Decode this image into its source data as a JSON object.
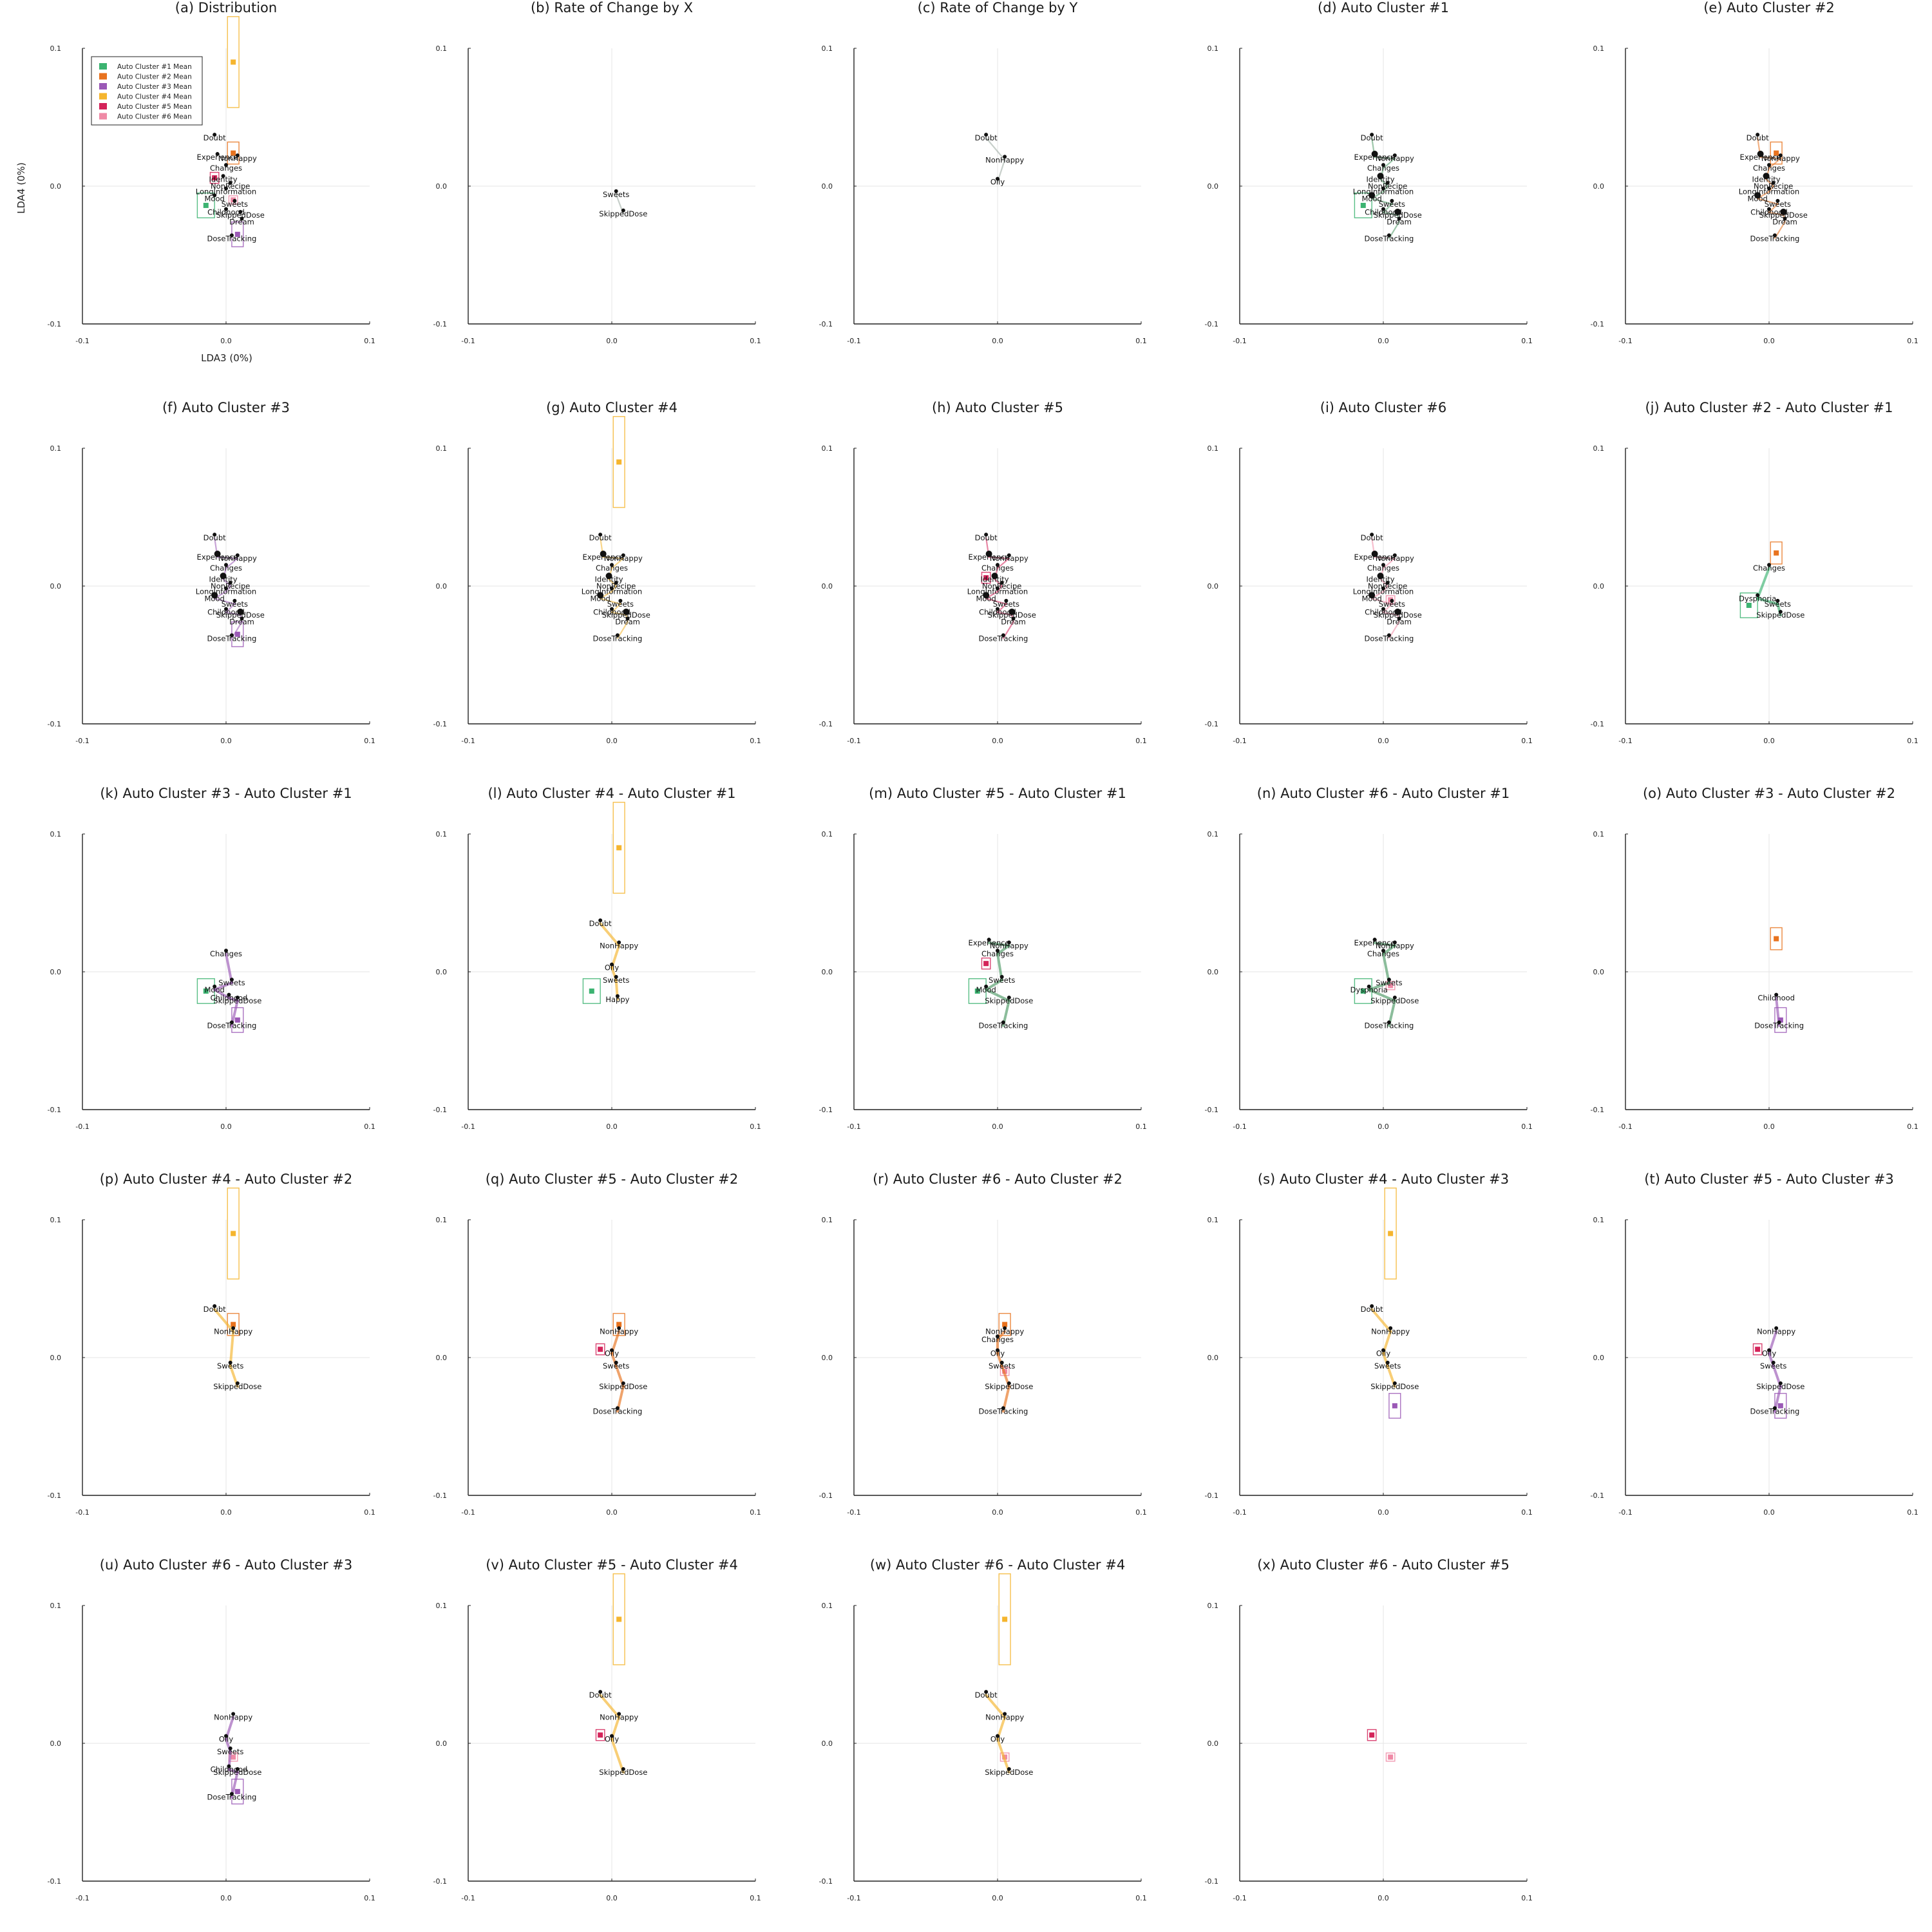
{
  "figure": {
    "legend_position": "top-left of panel (a)",
    "legend": [
      {
        "label": "Auto Cluster #1 Mean",
        "color": "#3cb371"
      },
      {
        "label": "Auto Cluster #2 Mean",
        "color": "#e8731f"
      },
      {
        "label": "Auto Cluster #3 Mean",
        "color": "#9b59b6"
      },
      {
        "label": "Auto Cluster #4 Mean",
        "color": "#f5b52e"
      },
      {
        "label": "Auto Cluster #5 Mean",
        "color": "#d4245a"
      },
      {
        "label": "Auto Cluster #6 Mean",
        "color": "#ef8aa6"
      }
    ]
  },
  "chart_data": [
    {
      "title": "(a) Distribution",
      "type": "scatter",
      "xlabel": "LDA3 (0%)",
      "ylabel": "LDA4 (0%)",
      "xlim": [
        -0.1,
        0.1
      ],
      "ylim": [
        -0.1,
        0.1
      ],
      "xticks": [
        "-0.1",
        "0.0",
        "0.1"
      ],
      "yticks": [
        "-0.1",
        "0.0",
        "0.1"
      ],
      "grid": true,
      "means": [
        {
          "cluster": 1,
          "x": -0.014,
          "y": -0.014
        },
        {
          "cluster": 2,
          "x": 0.005,
          "y": 0.024
        },
        {
          "cluster": 3,
          "x": 0.008,
          "y": -0.035
        },
        {
          "cluster": 4,
          "x": 0.005,
          "y": 0.09
        },
        {
          "cluster": 5,
          "x": -0.008,
          "y": 0.006
        },
        {
          "cluster": 6,
          "x": 0.005,
          "y": -0.01
        }
      ],
      "labels": [
        {
          "text": "Doubt",
          "x": -0.008,
          "y": 0.035
        },
        {
          "text": "Experience",
          "x": -0.006,
          "y": 0.021
        },
        {
          "text": "NonHappy",
          "x": 0.008,
          "y": 0.02
        },
        {
          "text": "Changes",
          "x": 0.0,
          "y": 0.013
        },
        {
          "text": "Identity",
          "x": -0.002,
          "y": 0.005
        },
        {
          "text": "NonRecipe",
          "x": 0.003,
          "y": 0.0
        },
        {
          "text": "LongInformation",
          "x": 0.0,
          "y": -0.004
        },
        {
          "text": "Mood",
          "x": -0.008,
          "y": -0.009
        },
        {
          "text": "Sweets",
          "x": 0.006,
          "y": -0.013
        },
        {
          "text": "Childhood",
          "x": 0.0,
          "y": -0.019
        },
        {
          "text": "SkippedDose",
          "x": 0.01,
          "y": -0.021
        },
        {
          "text": "Dream",
          "x": 0.011,
          "y": -0.026
        },
        {
          "text": "DoseTracking",
          "x": 0.004,
          "y": -0.038
        }
      ]
    },
    {
      "title": "(b) Rate of Change by X",
      "type": "scatter",
      "xlim": [
        -0.1,
        0.1
      ],
      "ylim": [
        -0.1,
        0.1
      ],
      "xticks": [
        "-0.1",
        "0.0",
        "0.1"
      ],
      "yticks": [
        "-0.1",
        "0.0",
        "0.1"
      ],
      "labels": [
        {
          "text": "Sweets",
          "x": 0.003,
          "y": -0.006
        },
        {
          "text": "SkippedDose",
          "x": 0.008,
          "y": -0.02
        }
      ]
    },
    {
      "title": "(c) Rate of Change by Y",
      "type": "scatter",
      "xlim": [
        -0.1,
        0.1
      ],
      "ylim": [
        -0.1,
        0.1
      ],
      "xticks": [
        "-0.1",
        "0.0",
        "0.1"
      ],
      "yticks": [
        "-0.1",
        "0.0",
        "0.1"
      ],
      "labels": [
        {
          "text": "Doubt",
          "x": -0.008,
          "y": 0.035
        },
        {
          "text": "NonHappy",
          "x": 0.005,
          "y": 0.019
        },
        {
          "text": "Oily",
          "x": 0.0,
          "y": 0.003
        }
      ]
    },
    {
      "title": "(d) Auto Cluster #1",
      "type": "scatter",
      "xlim": [
        -0.1,
        0.1
      ],
      "ylim": [
        -0.1,
        0.1
      ],
      "xticks": [
        "-0.1",
        "0.0",
        "0.1"
      ],
      "yticks": [
        "-0.1",
        "0.0",
        "0.1"
      ]
    },
    {
      "title": "(e) Auto Cluster #2",
      "type": "scatter",
      "xlim": [
        -0.1,
        0.1
      ],
      "ylim": [
        -0.1,
        0.1
      ],
      "xticks": [
        "-0.1",
        "0.0",
        "0.1"
      ],
      "yticks": [
        "-0.1",
        "0.0",
        "0.1"
      ]
    },
    {
      "title": "(f) Auto Cluster #3",
      "type": "scatter",
      "xlim": [
        -0.1,
        0.1
      ],
      "ylim": [
        -0.1,
        0.1
      ],
      "xticks": [
        "-0.1",
        "0.0",
        "0.1"
      ],
      "yticks": [
        "-0.1",
        "0.0",
        "0.1"
      ]
    },
    {
      "title": "(g) Auto Cluster #4",
      "type": "scatter",
      "xlim": [
        -0.1,
        0.1
      ],
      "ylim": [
        -0.1,
        0.1
      ],
      "xticks": [
        "-0.1",
        "0.0",
        "0.1"
      ],
      "yticks": [
        "-0.1",
        "0.0",
        "0.1"
      ]
    },
    {
      "title": "(h) Auto Cluster #5",
      "type": "scatter",
      "xlim": [
        -0.1,
        0.1
      ],
      "ylim": [
        -0.1,
        0.1
      ],
      "xticks": [
        "-0.1",
        "0.0",
        "0.1"
      ],
      "yticks": [
        "-0.1",
        "0.0",
        "0.1"
      ]
    },
    {
      "title": "(i) Auto Cluster #6",
      "type": "scatter",
      "xlim": [
        -0.1,
        0.1
      ],
      "ylim": [
        -0.1,
        0.1
      ],
      "xticks": [
        "-0.1",
        "0.0",
        "0.1"
      ],
      "yticks": [
        "-0.1",
        "0.0",
        "0.1"
      ]
    },
    {
      "title": "(j) Auto Cluster #2 - Auto Cluster #1",
      "type": "scatter",
      "xlim": [
        -0.1,
        0.1
      ],
      "ylim": [
        -0.1,
        0.1
      ],
      "xticks": [
        "-0.1",
        "0.0",
        "0.1"
      ],
      "yticks": [
        "-0.1",
        "0.0",
        "0.1"
      ],
      "labels": [
        {
          "text": "Changes",
          "x": 0.0,
          "y": 0.013
        },
        {
          "text": "Dysphoria",
          "x": -0.008,
          "y": -0.009
        },
        {
          "text": "Sweets",
          "x": 0.006,
          "y": -0.013
        },
        {
          "text": "SkippedDose",
          "x": 0.008,
          "y": -0.021
        }
      ]
    },
    {
      "title": "(k) Auto Cluster #3 - Auto Cluster #1",
      "type": "scatter",
      "xlim": [
        -0.1,
        0.1
      ],
      "ylim": [
        -0.1,
        0.1
      ],
      "xticks": [
        "-0.1",
        "0.0",
        "0.1"
      ],
      "yticks": [
        "-0.1",
        "0.0",
        "0.1"
      ],
      "labels": [
        {
          "text": "Changes",
          "x": 0.0,
          "y": 0.013
        },
        {
          "text": "Sweets",
          "x": 0.004,
          "y": -0.008
        },
        {
          "text": "Mood",
          "x": -0.008,
          "y": -0.013
        },
        {
          "text": "Childhood",
          "x": 0.002,
          "y": -0.019
        },
        {
          "text": "SkippedDose",
          "x": 0.008,
          "y": -0.021
        },
        {
          "text": "DoseTracking",
          "x": 0.004,
          "y": -0.039
        }
      ]
    },
    {
      "title": "(l) Auto Cluster #4 - Auto Cluster #1",
      "type": "scatter",
      "xlim": [
        -0.1,
        0.1
      ],
      "ylim": [
        -0.1,
        0.1
      ],
      "xticks": [
        "-0.1",
        "0.0",
        "0.1"
      ],
      "yticks": [
        "-0.1",
        "0.0",
        "0.1"
      ],
      "labels": [
        {
          "text": "Doubt",
          "x": -0.008,
          "y": 0.035
        },
        {
          "text": "NonHappy",
          "x": 0.005,
          "y": 0.019
        },
        {
          "text": "Oily",
          "x": 0.0,
          "y": 0.003
        },
        {
          "text": "Sweets",
          "x": 0.003,
          "y": -0.006
        },
        {
          "text": "Happy",
          "x": 0.004,
          "y": -0.02
        }
      ]
    },
    {
      "title": "(m) Auto Cluster #5 - Auto Cluster #1",
      "type": "scatter",
      "xlim": [
        -0.1,
        0.1
      ],
      "ylim": [
        -0.1,
        0.1
      ],
      "xticks": [
        "-0.1",
        "0.0",
        "0.1"
      ],
      "yticks": [
        "-0.1",
        "0.0",
        "0.1"
      ],
      "labels": [
        {
          "text": "Experience",
          "x": -0.006,
          "y": 0.021
        },
        {
          "text": "NonHappy",
          "x": 0.008,
          "y": 0.019
        },
        {
          "text": "Changes",
          "x": 0.0,
          "y": 0.013
        },
        {
          "text": "Sweets",
          "x": 0.003,
          "y": -0.006
        },
        {
          "text": "Mood",
          "x": -0.008,
          "y": -0.013
        },
        {
          "text": "SkippedDose",
          "x": 0.008,
          "y": -0.021
        },
        {
          "text": "DoseTracking",
          "x": 0.004,
          "y": -0.039
        }
      ]
    },
    {
      "title": "(n) Auto Cluster #6 - Auto Cluster #1",
      "type": "scatter",
      "xlim": [
        -0.1,
        0.1
      ],
      "ylim": [
        -0.1,
        0.1
      ],
      "xticks": [
        "-0.1",
        "0.0",
        "0.1"
      ],
      "yticks": [
        "-0.1",
        "0.0",
        "0.1"
      ],
      "labels": [
        {
          "text": "Experience",
          "x": -0.006,
          "y": 0.021
        },
        {
          "text": "NonHappy",
          "x": 0.008,
          "y": 0.019
        },
        {
          "text": "Changes",
          "x": 0.0,
          "y": 0.013
        },
        {
          "text": "Sweets",
          "x": 0.004,
          "y": -0.008
        },
        {
          "text": "Dysphoria",
          "x": -0.01,
          "y": -0.013
        },
        {
          "text": "SkippedDose",
          "x": 0.008,
          "y": -0.021
        },
        {
          "text": "DoseTracking",
          "x": 0.004,
          "y": -0.039
        }
      ]
    },
    {
      "title": "(o) Auto Cluster #3 - Auto Cluster #2",
      "type": "scatter",
      "xlim": [
        -0.1,
        0.1
      ],
      "ylim": [
        -0.1,
        0.1
      ],
      "xticks": [
        "-0.1",
        "0.0",
        "0.1"
      ],
      "yticks": [
        "-0.1",
        "0.0",
        "0.1"
      ],
      "labels": [
        {
          "text": "Childhood",
          "x": 0.005,
          "y": -0.019
        },
        {
          "text": "DoseTracking",
          "x": 0.007,
          "y": -0.039
        }
      ]
    },
    {
      "title": "(p) Auto Cluster #4 - Auto Cluster #2",
      "type": "scatter",
      "xlim": [
        -0.1,
        0.1
      ],
      "ylim": [
        -0.1,
        0.1
      ],
      "xticks": [
        "-0.1",
        "0.0",
        "0.1"
      ],
      "yticks": [
        "-0.1",
        "0.0",
        "0.1"
      ],
      "labels": [
        {
          "text": "Doubt",
          "x": -0.008,
          "y": 0.035
        },
        {
          "text": "NonHappy",
          "x": 0.005,
          "y": 0.019
        },
        {
          "text": "Sweets",
          "x": 0.003,
          "y": -0.006
        },
        {
          "text": "SkippedDose",
          "x": 0.008,
          "y": -0.021
        }
      ]
    },
    {
      "title": "(q) Auto Cluster #5 - Auto Cluster #2",
      "type": "scatter",
      "xlim": [
        -0.1,
        0.1
      ],
      "ylim": [
        -0.1,
        0.1
      ],
      "xticks": [
        "-0.1",
        "0.0",
        "0.1"
      ],
      "yticks": [
        "-0.1",
        "0.0",
        "0.1"
      ],
      "labels": [
        {
          "text": "NonHappy",
          "x": 0.005,
          "y": 0.019
        },
        {
          "text": "Oily",
          "x": 0.0,
          "y": 0.003
        },
        {
          "text": "Sweets",
          "x": 0.003,
          "y": -0.006
        },
        {
          "text": "SkippedDose",
          "x": 0.008,
          "y": -0.021
        },
        {
          "text": "DoseTracking",
          "x": 0.004,
          "y": -0.039
        }
      ]
    },
    {
      "title": "(r) Auto Cluster #6 - Auto Cluster #2",
      "type": "scatter",
      "xlim": [
        -0.1,
        0.1
      ],
      "ylim": [
        -0.1,
        0.1
      ],
      "xticks": [
        "-0.1",
        "0.0",
        "0.1"
      ],
      "yticks": [
        "-0.1",
        "0.0",
        "0.1"
      ],
      "labels": [
        {
          "text": "NonHappy",
          "x": 0.005,
          "y": 0.019
        },
        {
          "text": "Changes",
          "x": 0.0,
          "y": 0.013
        },
        {
          "text": "Oily",
          "x": 0.0,
          "y": 0.003
        },
        {
          "text": "Sweets",
          "x": 0.003,
          "y": -0.006
        },
        {
          "text": "SkippedDose",
          "x": 0.008,
          "y": -0.021
        },
        {
          "text": "DoseTracking",
          "x": 0.004,
          "y": -0.039
        }
      ]
    },
    {
      "title": "(s) Auto Cluster #4 - Auto Cluster #3",
      "type": "scatter",
      "xlim": [
        -0.1,
        0.1
      ],
      "ylim": [
        -0.1,
        0.1
      ],
      "xticks": [
        "-0.1",
        "0.0",
        "0.1"
      ],
      "yticks": [
        "-0.1",
        "0.0",
        "0.1"
      ],
      "labels": [
        {
          "text": "Doubt",
          "x": -0.008,
          "y": 0.035
        },
        {
          "text": "NonHappy",
          "x": 0.005,
          "y": 0.019
        },
        {
          "text": "Oily",
          "x": 0.0,
          "y": 0.003
        },
        {
          "text": "Sweets",
          "x": 0.003,
          "y": -0.006
        },
        {
          "text": "SkippedDose",
          "x": 0.008,
          "y": -0.021
        }
      ]
    },
    {
      "title": "(t) Auto Cluster #5 - Auto Cluster #3",
      "type": "scatter",
      "xlim": [
        -0.1,
        0.1
      ],
      "ylim": [
        -0.1,
        0.1
      ],
      "xticks": [
        "-0.1",
        "0.0",
        "0.1"
      ],
      "yticks": [
        "-0.1",
        "0.0",
        "0.1"
      ],
      "labels": [
        {
          "text": "NonHappy",
          "x": 0.005,
          "y": 0.019
        },
        {
          "text": "Oily",
          "x": 0.0,
          "y": 0.003
        },
        {
          "text": "Sweets",
          "x": 0.003,
          "y": -0.006
        },
        {
          "text": "SkippedDose",
          "x": 0.008,
          "y": -0.021
        },
        {
          "text": "DoseTracking",
          "x": 0.004,
          "y": -0.039
        }
      ]
    },
    {
      "title": "(u) Auto Cluster #6 - Auto Cluster #3",
      "type": "scatter",
      "xlim": [
        -0.1,
        0.1
      ],
      "ylim": [
        -0.1,
        0.1
      ],
      "xticks": [
        "-0.1",
        "0.0",
        "0.1"
      ],
      "yticks": [
        "-0.1",
        "0.0",
        "0.1"
      ],
      "labels": [
        {
          "text": "NonHappy",
          "x": 0.005,
          "y": 0.019
        },
        {
          "text": "Oily",
          "x": 0.0,
          "y": 0.003
        },
        {
          "text": "Sweets",
          "x": 0.003,
          "y": -0.006
        },
        {
          "text": "Childhood",
          "x": 0.002,
          "y": -0.019
        },
        {
          "text": "SkippedDose",
          "x": 0.008,
          "y": -0.021
        },
        {
          "text": "DoseTracking",
          "x": 0.004,
          "y": -0.039
        }
      ]
    },
    {
      "title": "(v) Auto Cluster #5 - Auto Cluster #4",
      "type": "scatter",
      "xlim": [
        -0.1,
        0.1
      ],
      "ylim": [
        -0.1,
        0.1
      ],
      "xticks": [
        "-0.1",
        "0.0",
        "0.1"
      ],
      "yticks": [
        "-0.1",
        "0.0",
        "0.1"
      ],
      "labels": [
        {
          "text": "Doubt",
          "x": -0.008,
          "y": 0.035
        },
        {
          "text": "NonHappy",
          "x": 0.005,
          "y": 0.019
        },
        {
          "text": "Oily",
          "x": 0.0,
          "y": 0.003
        },
        {
          "text": "SkippedDose",
          "x": 0.008,
          "y": -0.021
        }
      ]
    },
    {
      "title": "(w) Auto Cluster #6 - Auto Cluster #4",
      "type": "scatter",
      "xlim": [
        -0.1,
        0.1
      ],
      "ylim": [
        -0.1,
        0.1
      ],
      "xticks": [
        "-0.1",
        "0.0",
        "0.1"
      ],
      "yticks": [
        "-0.1",
        "0.0",
        "0.1"
      ],
      "labels": [
        {
          "text": "Doubt",
          "x": -0.008,
          "y": 0.035
        },
        {
          "text": "NonHappy",
          "x": 0.005,
          "y": 0.019
        },
        {
          "text": "Oily",
          "x": 0.0,
          "y": 0.003
        },
        {
          "text": "SkippedDose",
          "x": 0.008,
          "y": -0.021
        }
      ]
    },
    {
      "title": "(x) Auto Cluster #6 - Auto Cluster #5",
      "type": "scatter",
      "xlim": [
        -0.1,
        0.1
      ],
      "ylim": [
        -0.1,
        0.1
      ],
      "xticks": [
        "-0.1",
        "0.0",
        "0.1"
      ],
      "yticks": [
        "-0.1",
        "0.0",
        "0.1"
      ]
    }
  ]
}
